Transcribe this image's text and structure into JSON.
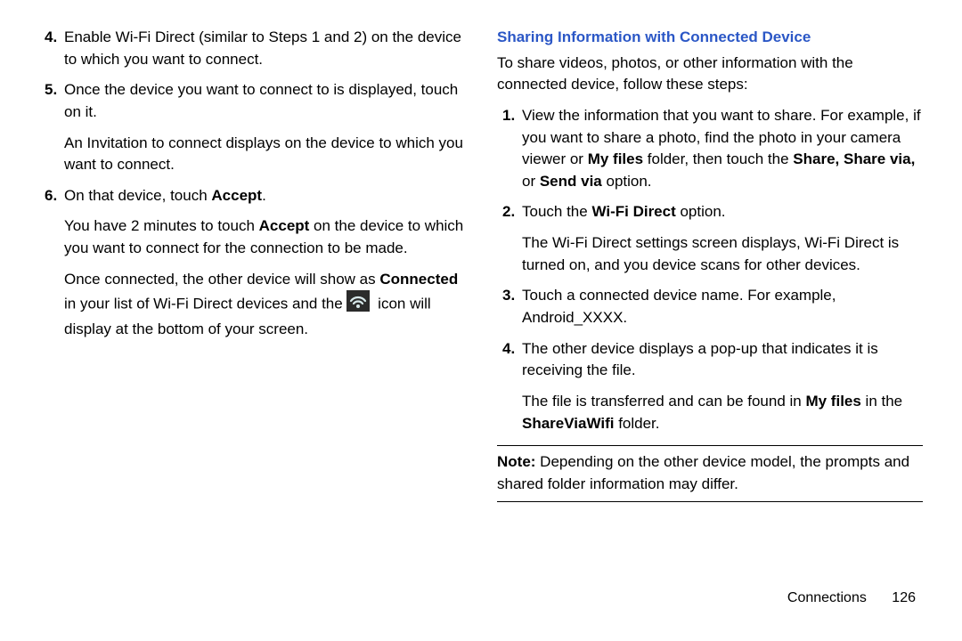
{
  "left": {
    "steps": [
      {
        "num": "4.",
        "paragraphs": [
          [
            {
              "t": "Enable Wi-Fi Direct (similar to Steps 1 and 2) on the device to which you want to connect."
            }
          ]
        ]
      },
      {
        "num": "5.",
        "paragraphs": [
          [
            {
              "t": "Once the device you want to connect to is displayed, touch on it."
            }
          ],
          [
            {
              "t": "An Invitation to connect displays on the device to which you want to connect."
            }
          ]
        ]
      },
      {
        "num": "6.",
        "paragraphs": [
          [
            {
              "t": "On that device, touch "
            },
            {
              "t": "Accept",
              "b": true
            },
            {
              "t": "."
            }
          ],
          [
            {
              "t": "You have 2 minutes to touch "
            },
            {
              "t": "Accept",
              "b": true
            },
            {
              "t": " on the device to which you want to connect for the connection to be made."
            }
          ],
          [
            {
              "t": "Once connected, the other device will show as "
            },
            {
              "t": "Connected",
              "b": true
            },
            {
              "t": " in your list of Wi-Fi Direct devices and the "
            },
            {
              "icon": "wifi-direct-icon"
            },
            {
              "t": " icon will display at the bottom of your screen."
            }
          ]
        ]
      }
    ]
  },
  "right": {
    "sectionTitle": "Sharing Information with Connected Device",
    "intro": "To share videos, photos, or other information with the connected device, follow these steps:",
    "steps": [
      {
        "num": "1.",
        "paragraphs": [
          [
            {
              "t": "View the information that you want to share. For example, if you want to share a photo, find the photo in your camera viewer or "
            },
            {
              "t": "My files",
              "b": true
            },
            {
              "t": " folder, then touch the "
            },
            {
              "t": "Share, Share via,",
              "b": true
            },
            {
              "t": " or "
            },
            {
              "t": "Send via",
              "b": true
            },
            {
              "t": " option."
            }
          ]
        ]
      },
      {
        "num": "2.",
        "paragraphs": [
          [
            {
              "t": "Touch the "
            },
            {
              "t": "Wi-Fi Direct",
              "b": true
            },
            {
              "t": " option."
            }
          ],
          [
            {
              "t": "The Wi-Fi Direct settings screen displays, Wi-Fi Direct is turned on, and you device scans for other devices."
            }
          ]
        ]
      },
      {
        "num": "3.",
        "paragraphs": [
          [
            {
              "t": "Touch a connected device name. For example, Android_XXXX."
            }
          ]
        ]
      },
      {
        "num": "4.",
        "paragraphs": [
          [
            {
              "t": "The other device displays a pop-up that indicates it is receiving the file."
            }
          ],
          [
            {
              "t": "The file is transferred and can be found in "
            },
            {
              "t": "My files",
              "b": true
            },
            {
              "t": " in the "
            },
            {
              "t": "ShareViaWifi",
              "b": true
            },
            {
              "t": " folder."
            }
          ]
        ]
      }
    ],
    "note": [
      {
        "t": "Note:",
        "b": true
      },
      {
        "t": " Depending on the other device model, the prompts and shared folder information may differ."
      }
    ]
  },
  "footer": {
    "section": "Connections",
    "page": "126"
  }
}
